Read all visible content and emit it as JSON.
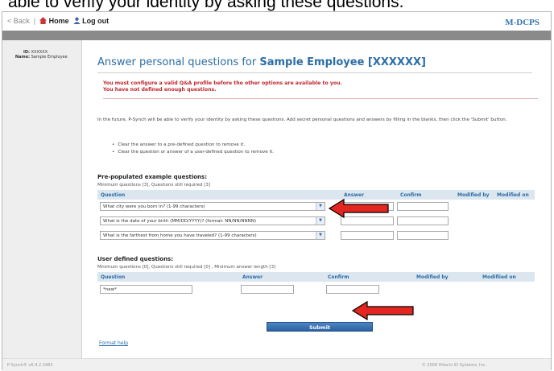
{
  "caption": "able to verify your identity by asking these questions.",
  "topbar": {
    "back": "Back",
    "home": "Home",
    "logout": "Log out",
    "brand": "M-DCPS"
  },
  "sidebar": {
    "id_label": "ID:",
    "id_value": "XXXXXX",
    "name_label": "Name:",
    "name_value": "Sample Employee"
  },
  "page": {
    "title_prefix": "Answer personal questions for",
    "title_name": "Sample Employee [XXXXXX]",
    "alert_line1": "You must configure a valid Q&A profile before the other options are available to you.",
    "alert_line2": "You have not defined enough questions.",
    "intro": "In the future, P-Synch will be able to verify your identity by asking these questions. Add secret personal questions and answers by filling in the blanks, then click the 'Submit' button.",
    "bullet1": "Clear the answer to a pre-defined question to remove it.",
    "bullet2": "Clear the question or answer of a user-defined question to remove it."
  },
  "prepopulated": {
    "title": "Pre-populated example questions:",
    "sub": "Minimum questions [3], Questions still required [3]",
    "headers": {
      "question": "Question",
      "answer": "Answer",
      "confirm": "Confirm",
      "modified_by": "Modified by",
      "modified_on": "Modified on"
    },
    "questions": [
      "What city were you born in? (1-99 characters)",
      "What is the date of your birth (MM/DD/YYYY)? (format: NN/NN/NNNN)",
      "What is the farthest from home you have traveled? (1-99 characters)"
    ]
  },
  "userdefined": {
    "title": "User defined questions:",
    "sub": "Minimum questions [0], Questions still required [0] , Minimum answer length [3]",
    "headers": {
      "question": "Question",
      "answer": "Answer",
      "confirm": "Confirm",
      "modified_by": "Modified by",
      "modified_on": "Modifiied on"
    },
    "new_value": "*new*"
  },
  "submit_label": "Submit",
  "help_link": "Format help",
  "footer": {
    "left": "P-Synch® v6.4.2.3483",
    "right": "© 2008 Hitachi ID Systems, Inc."
  },
  "colors": {
    "accent": "#2b6da5",
    "alert": "#c0272d",
    "arrow": "#e3261f"
  }
}
